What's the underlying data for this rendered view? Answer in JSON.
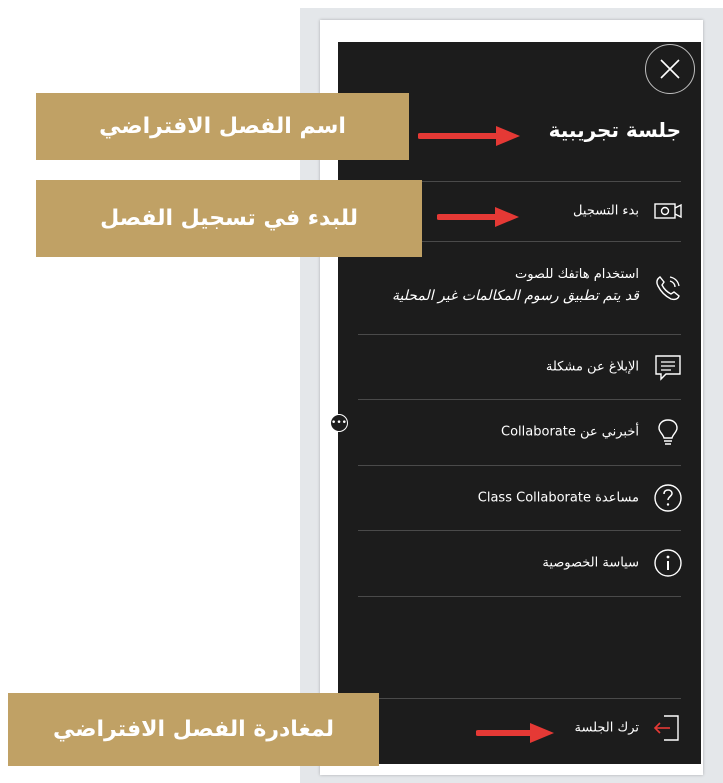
{
  "panel": {
    "session_title": "جلسة تجريبية",
    "items": [
      {
        "label": "بدء التسجيل",
        "icon": "record-camera-icon"
      },
      {
        "label": "استخدام هاتفك للصوت",
        "sub": "قد يتم تطبيق رسوم المكالمات غير المحلية",
        "icon": "phone-icon"
      },
      {
        "label": "الإبلاغ عن مشكلة",
        "icon": "report-message-icon"
      },
      {
        "label": "أخبرني عن Collaborate",
        "icon": "lightbulb-icon"
      },
      {
        "label": "مساعدة Class Collaborate",
        "icon": "help-icon"
      },
      {
        "label": "سياسة الخصوصية",
        "icon": "info-icon"
      }
    ],
    "leave": {
      "label": "ترك الجلسة",
      "icon": "exit-icon"
    }
  },
  "callouts": {
    "class_name": "اسم الفصل الافتراضي",
    "start_recording": "للبدء في تسجيل الفصل",
    "leave_class": "لمغادرة الفصل الافتراضي"
  },
  "colors": {
    "callout_bg": "#c0a165",
    "panel_bg": "#1c1c1c",
    "arrow": "#e53935"
  }
}
